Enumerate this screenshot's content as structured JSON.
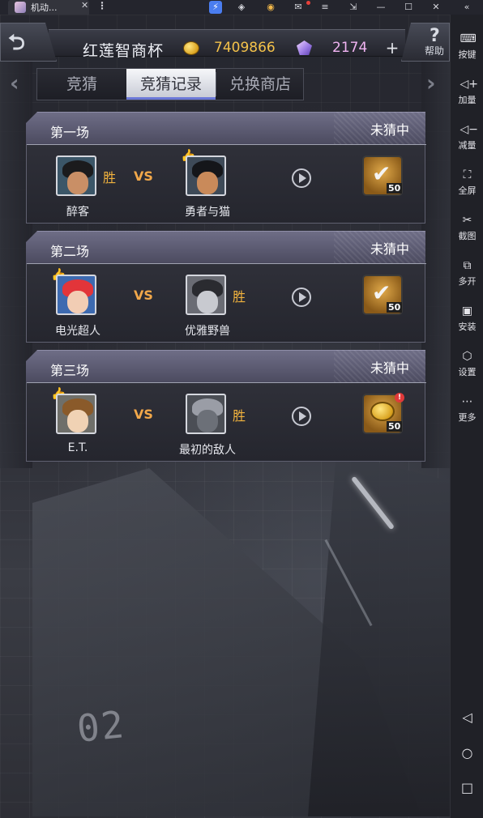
{
  "titlebar": {
    "tab_title": "机动...",
    "tab_close": "✕",
    "more": "⋮",
    "controls": {
      "minimize": "—",
      "maximize": "☐",
      "close": "✕",
      "collapse": "«"
    }
  },
  "header": {
    "title": "红莲智商杯",
    "coins": "7409866",
    "gems": "2174",
    "plus": "+",
    "help_label": "帮助"
  },
  "tabs": [
    {
      "label": "竞猜"
    },
    {
      "label": "竞猜记录"
    },
    {
      "label": "兑换商店"
    }
  ],
  "matches": [
    {
      "title": "第一场",
      "status": "未猜中",
      "left_name": "醉客",
      "right_name": "勇者与猫",
      "winner_label": "胜",
      "vs": "VS",
      "reward_qty": "50"
    },
    {
      "title": "第二场",
      "status": "未猜中",
      "left_name": "电光超人",
      "right_name": "优雅野兽",
      "winner_label": "胜",
      "vs": "VS",
      "reward_qty": "50"
    },
    {
      "title": "第三场",
      "status": "未猜中",
      "left_name": "E.T.",
      "right_name": "最初的敌人",
      "winner_label": "胜",
      "vs": "VS",
      "reward_qty": "50",
      "reward_alert": "!"
    }
  ],
  "sidebar": {
    "items": [
      {
        "label": "按键",
        "icon": "keyboard-icon"
      },
      {
        "label": "加量",
        "icon": "volume-up-icon"
      },
      {
        "label": "减量",
        "icon": "volume-down-icon"
      },
      {
        "label": "全屏",
        "icon": "fullscreen-icon"
      },
      {
        "label": "截图",
        "icon": "scissors-icon"
      },
      {
        "label": "多开",
        "icon": "multi-instance-icon"
      },
      {
        "label": "安装",
        "icon": "apk-icon"
      },
      {
        "label": "设置",
        "icon": "gear-icon"
      },
      {
        "label": "更多",
        "icon": "more-icon"
      }
    ]
  },
  "background_mark": "02"
}
